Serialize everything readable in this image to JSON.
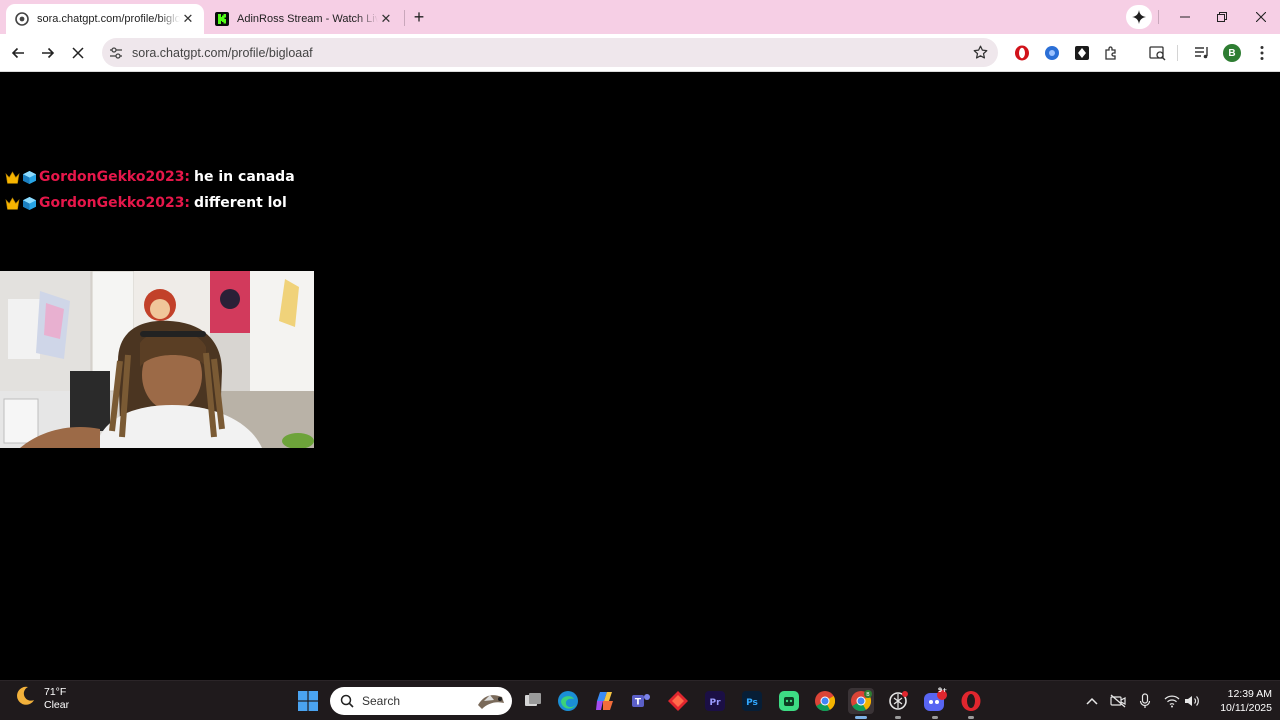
{
  "browser": {
    "tabs": [
      {
        "title": "sora.chatgpt.com/profile/bigloaaf",
        "favicon": "sora-icon",
        "active": true
      },
      {
        "title": "AdinRoss Stream - Watch Live on Kick",
        "favicon": "kick-icon",
        "active": false
      }
    ],
    "url": "sora.chatgpt.com/profile/bigloaaf",
    "profile_initial": "B"
  },
  "chat": {
    "messages": [
      {
        "user": "GordonGekko2023:",
        "text": "he in canada",
        "badges": [
          "crown-icon",
          "cube-icon"
        ]
      },
      {
        "user": "GordonGekko2023:",
        "text": "different lol",
        "badges": [
          "crown-icon",
          "cube-icon"
        ]
      }
    ],
    "username_color": "#e6174a"
  },
  "taskbar": {
    "weather": {
      "temp": "71°F",
      "condition": "Clear"
    },
    "search_placeholder": "Search",
    "clock": {
      "time": "12:39 AM",
      "date": "10/11/2025"
    },
    "discord_badge": "9+"
  },
  "colors": {
    "tabstrip": "#f6cfe5",
    "accent": "#e6174a",
    "taskbar": "#1f1a1c"
  }
}
